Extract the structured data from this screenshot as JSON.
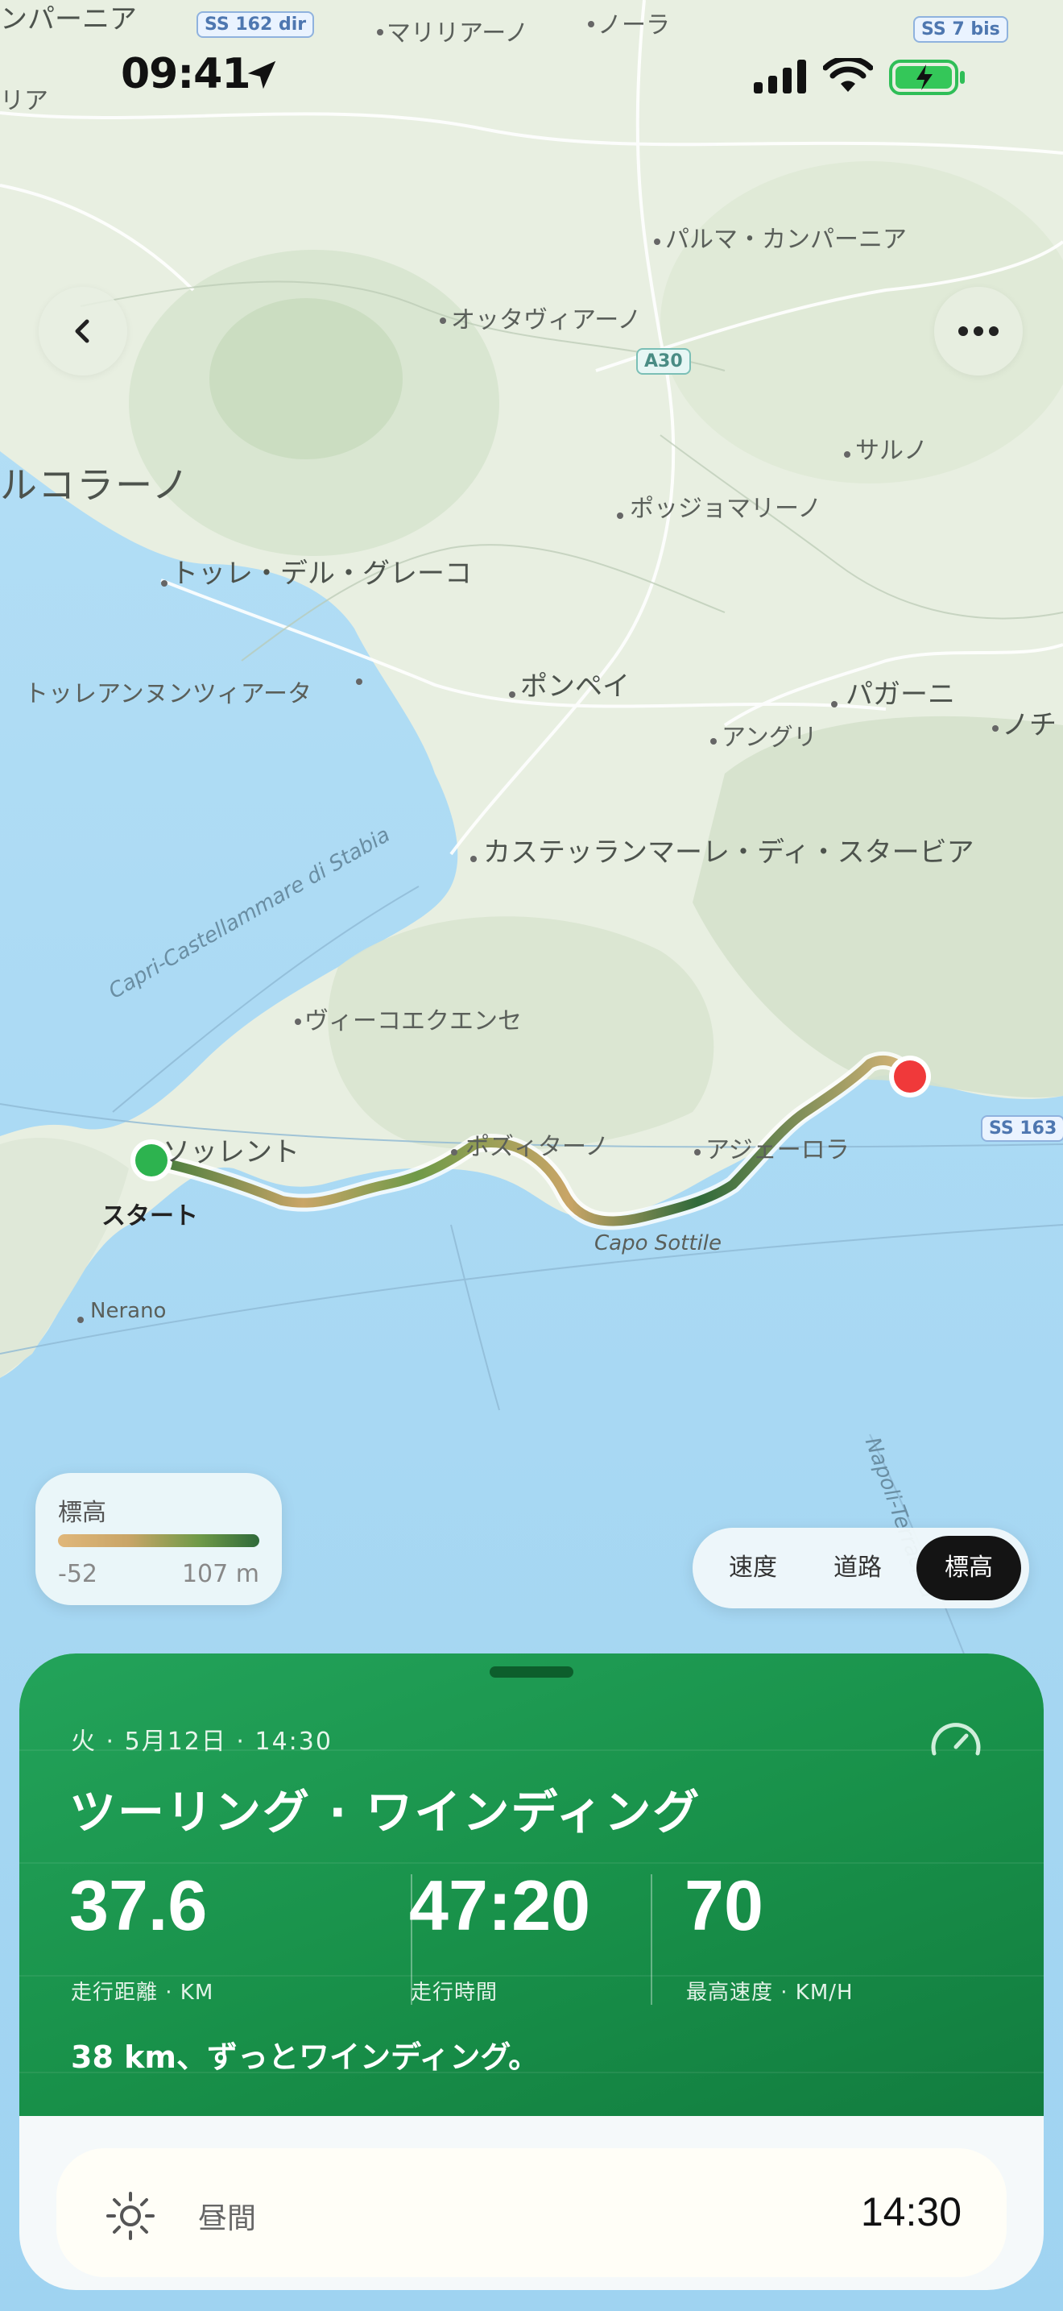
{
  "status_bar": {
    "time": "09:41"
  },
  "map": {
    "labels": {
      "campania": "ンパーニア",
      "marigliano": "マリリアーノ",
      "nola": "ノーラ",
      "ria": "リア",
      "palma": "パルマ・カンパーニア",
      "ottaviano": "オッタヴィアーノ",
      "sarno": "サルノ",
      "ercolano": "ルコラーノ",
      "poggiomarino": "ポッジョマリーノ",
      "torre_greco": "トッレ・デル・グレーコ",
      "torre_annunziata": "トッレアンヌンツィアータ",
      "pompei": "ポンペイ",
      "pagani": "パガーニ",
      "angri": "アングリ",
      "nochi": "ノチ",
      "castellammare": "カステッランマーレ・ディ・スタービア",
      "vico": "ヴィーコエクエンセ",
      "sorrento": "ソッレント",
      "positano": "ポズィターノ",
      "agerola": "アジェーロラ",
      "capo_sottile": "Capo Sottile",
      "nerano": "Nerano",
      "ferry_route": "Capri-Castellammare di Stabia",
      "ferry_route_2": "Napoli-Terracina"
    },
    "roads": {
      "ss162": "SS 162 dir",
      "ss7": "SS 7 bis",
      "a30": "A30",
      "ss163": "SS 163"
    },
    "start_label": "スタート"
  },
  "legend": {
    "title": "標高",
    "min": "-52",
    "max": "107 m"
  },
  "segmented": {
    "options": [
      "速度",
      "道路",
      "標高"
    ],
    "selected": "標高"
  },
  "ride": {
    "date": "火 · 5月12日 · 14:30",
    "title": "ツーリング · ワインディング",
    "distance": "37.6",
    "distance_label": "走行距離 · KM",
    "duration": "47:20",
    "duration_label": "走行時間",
    "max_speed": "70",
    "max_speed_label": "最高速度 · KM/H",
    "note": "38 km、ずっとワインディング。"
  },
  "time_of_day": {
    "label": "昼間",
    "value": "14:30"
  },
  "colors": {
    "accent": "#1a9a4f",
    "start": "#2db34f",
    "end": "#f0393a",
    "active_segment": "#141414"
  },
  "icons": [
    "location-arrow-icon",
    "signal-icon",
    "wifi-icon",
    "battery-charging-icon",
    "back-chevron-icon",
    "more-icon",
    "speedometer-icon",
    "sun-icon"
  ]
}
